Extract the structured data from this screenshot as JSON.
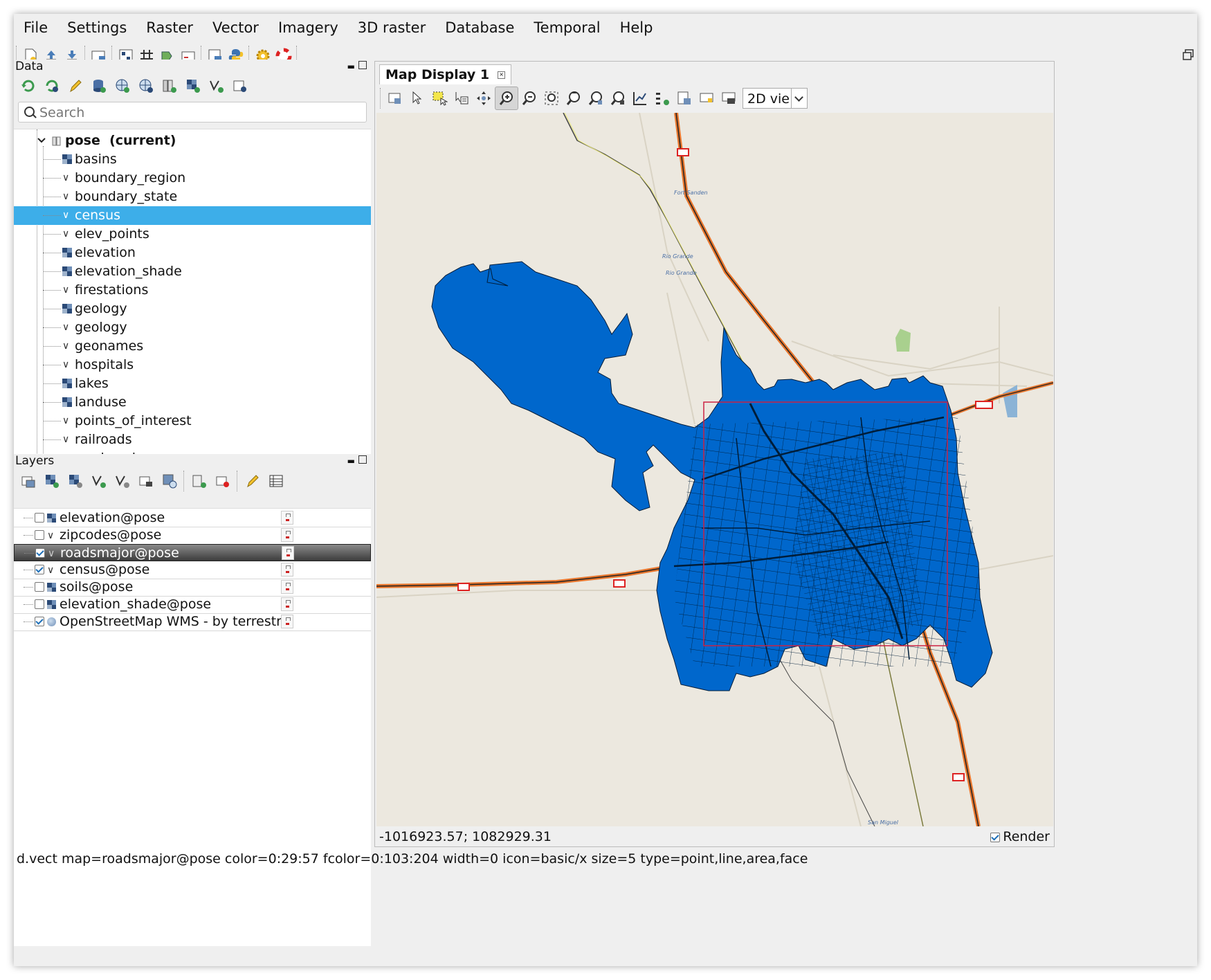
{
  "menubar": [
    "File",
    "Settings",
    "Raster",
    "Vector",
    "Imagery",
    "3D raster",
    "Database",
    "Temporal",
    "Help"
  ],
  "data_panel": {
    "title": "Data",
    "search_placeholder": "Search",
    "mapset": "pose  (current)",
    "items": [
      {
        "name": "basins",
        "type": "raster"
      },
      {
        "name": "boundary_region",
        "type": "vector"
      },
      {
        "name": "boundary_state",
        "type": "vector"
      },
      {
        "name": "census",
        "type": "vector",
        "selected": true
      },
      {
        "name": "elev_points",
        "type": "vector"
      },
      {
        "name": "elevation",
        "type": "raster"
      },
      {
        "name": "elevation_shade",
        "type": "raster"
      },
      {
        "name": "firestations",
        "type": "vector"
      },
      {
        "name": "geology",
        "type": "raster"
      },
      {
        "name": "geology",
        "type": "vector"
      },
      {
        "name": "geonames",
        "type": "vector"
      },
      {
        "name": "hospitals",
        "type": "vector"
      },
      {
        "name": "lakes",
        "type": "raster"
      },
      {
        "name": "landuse",
        "type": "raster"
      },
      {
        "name": "points_of_interest",
        "type": "vector"
      },
      {
        "name": "railroads",
        "type": "vector"
      },
      {
        "name": "roadsmajor",
        "type": "vector"
      }
    ]
  },
  "layers_panel": {
    "title": "Layers",
    "layers": [
      {
        "name": "elevation@pose",
        "type": "raster",
        "checked": false
      },
      {
        "name": "zipcodes@pose",
        "type": "vector",
        "checked": false
      },
      {
        "name": "roadsmajor@pose",
        "type": "vector",
        "checked": true,
        "selected": true
      },
      {
        "name": "census@pose",
        "type": "vector",
        "checked": true
      },
      {
        "name": "soils@pose",
        "type": "raster",
        "checked": false
      },
      {
        "name": "elevation_shade@pose",
        "type": "raster",
        "checked": false
      },
      {
        "name": "OpenStreetMap WMS - by terrestris",
        "type": "wms",
        "checked": true
      }
    ]
  },
  "map_display": {
    "tab_title": "Map Display 1",
    "view_select": "2D vie",
    "coordinates": "-1016923.57; 1082929.31",
    "render_label": "Render",
    "render_checked": true,
    "map_labels": [
      "Rio Grande",
      "Rio Grande",
      "Fort Sanden",
      "San Miguel"
    ],
    "colors": {
      "census_fill": "#0067cc",
      "census_edge": "#001d39",
      "road_orange": "#e8772e",
      "region_box": "#cc2244",
      "map_bg": "#ece8df"
    }
  },
  "status_command": "d.vect map=roadsmajor@pose color=0:29:57 fcolor=0:103:204 width=0 icon=basic/x size=5 type=point,line,area,face"
}
